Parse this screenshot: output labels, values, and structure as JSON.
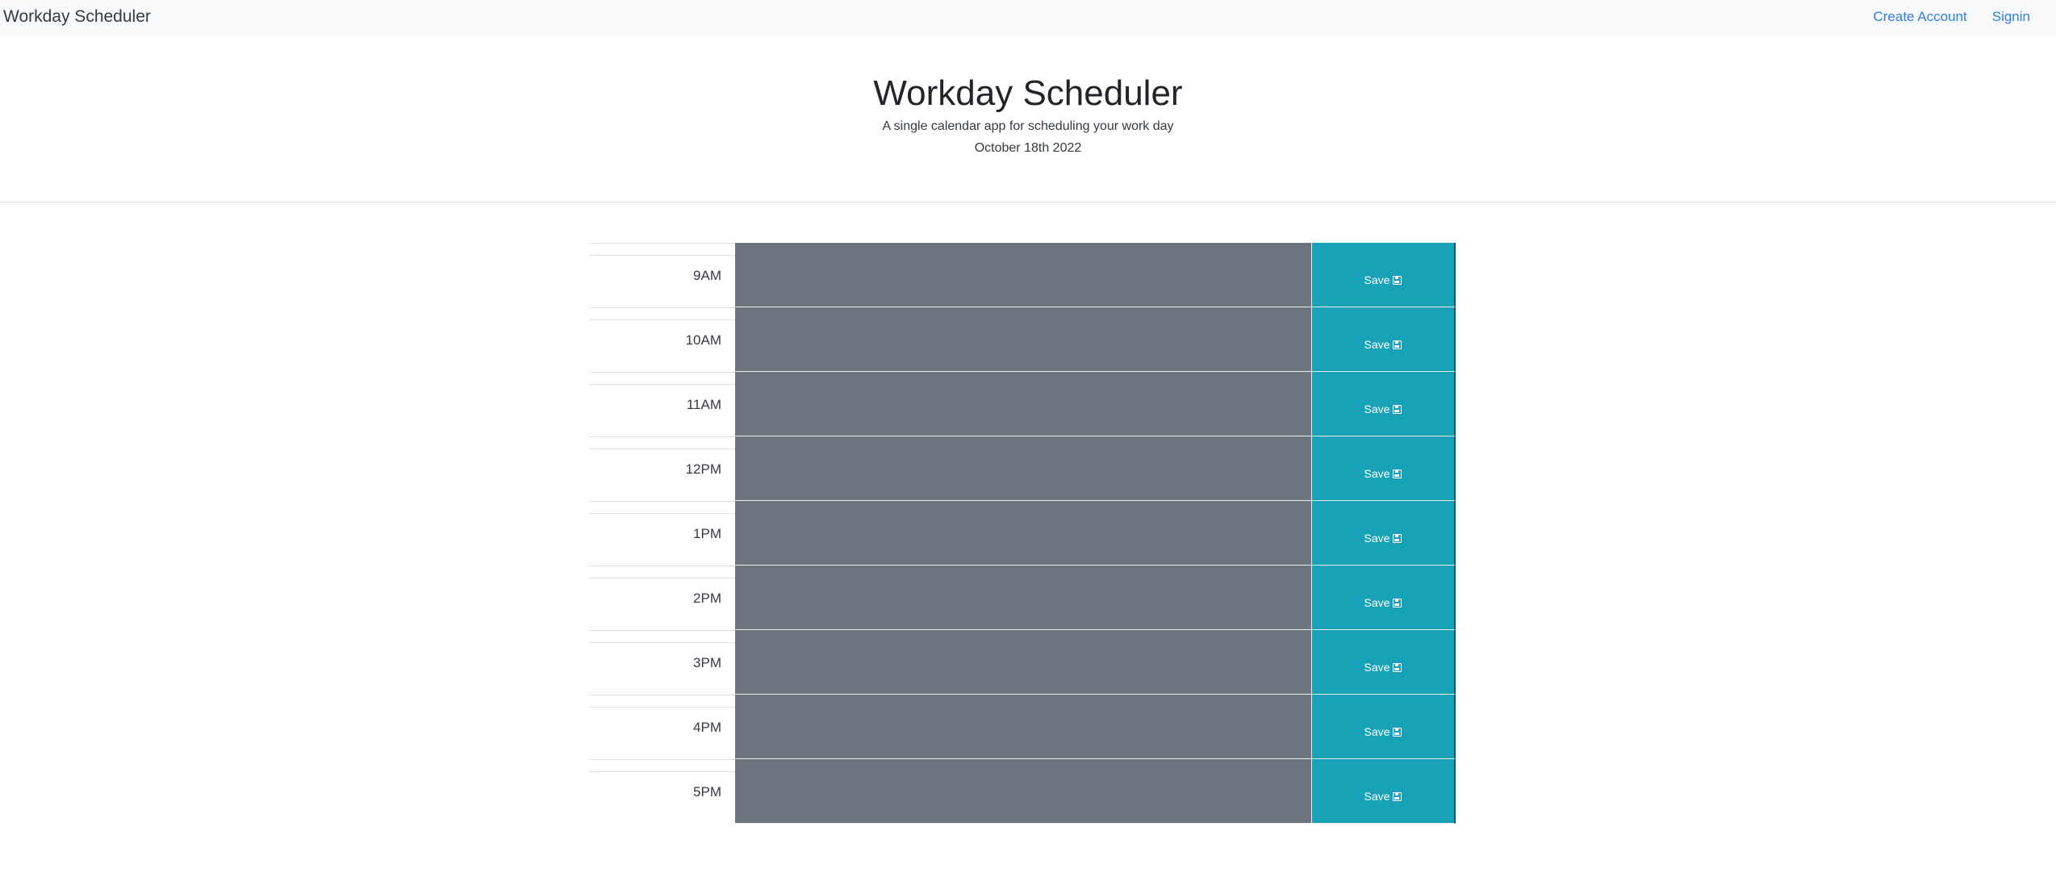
{
  "navbar": {
    "brand": "Workday Scheduler",
    "links": [
      "Create Account",
      "Signin"
    ]
  },
  "header": {
    "title": "Workday Scheduler",
    "subtitle": "A single calendar app for scheduling your work day",
    "date": "October 18th 2022"
  },
  "scheduler": {
    "save_label": "Save",
    "save_icon": "floppy-disk-icon",
    "rows": [
      {
        "hour": "9AM",
        "description": ""
      },
      {
        "hour": "10AM",
        "description": ""
      },
      {
        "hour": "11AM",
        "description": ""
      },
      {
        "hour": "12PM",
        "description": ""
      },
      {
        "hour": "1PM",
        "description": ""
      },
      {
        "hour": "2PM",
        "description": ""
      },
      {
        "hour": "3PM",
        "description": ""
      },
      {
        "hour": "4PM",
        "description": ""
      },
      {
        "hour": "5PM",
        "description": ""
      }
    ]
  },
  "colors": {
    "navbar_bg": "#f8f9fa",
    "link": "#2f7fe5",
    "past_block": "#6c737c",
    "save_button": "#17a2b8"
  }
}
